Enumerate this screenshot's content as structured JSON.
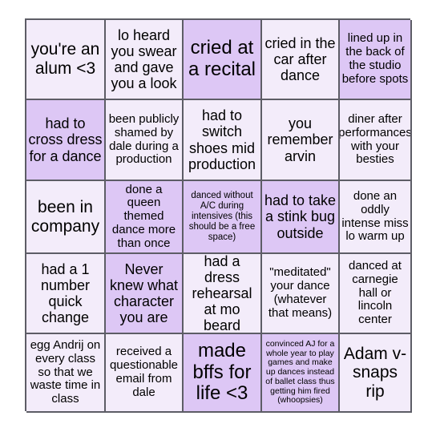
{
  "card": {
    "type": "bingo-card",
    "rows": 5,
    "columns": 5,
    "colors": {
      "cell_background": "#f3ecfa",
      "cell_marked_background": "#ddc7f5",
      "border": "#5d5d66",
      "text": "#000000",
      "page_background": "#ffffff"
    },
    "cells": [
      {
        "id": "r1c1",
        "text": "you're an alum <3",
        "marked": false,
        "size": "sz-lg"
      },
      {
        "id": "r1c2",
        "text": "lo heard you swear and gave you a look",
        "marked": false,
        "size": "sz-md"
      },
      {
        "id": "r1c3",
        "text": "cried at a recital",
        "marked": true,
        "size": "sz-xl"
      },
      {
        "id": "r1c4",
        "text": "cried in the car after dance",
        "marked": false,
        "size": "sz-md"
      },
      {
        "id": "r1c5",
        "text": "lined up in the back of the studio before spots",
        "marked": true,
        "size": "sz-sm"
      },
      {
        "id": "r2c1",
        "text": "had to cross dress for a dance",
        "marked": true,
        "size": "sz-md"
      },
      {
        "id": "r2c2",
        "text": "been publicly shamed by dale during a production",
        "marked": false,
        "size": "sz-sm"
      },
      {
        "id": "r2c3",
        "text": "had to switch shoes mid production",
        "marked": false,
        "size": "sz-md"
      },
      {
        "id": "r2c4",
        "text": "you remember arvin",
        "marked": false,
        "size": "sz-md"
      },
      {
        "id": "r2c5",
        "text": "diner after performances with your besties",
        "marked": false,
        "size": "sz-sm"
      },
      {
        "id": "r3c1",
        "text": "been in company",
        "marked": false,
        "size": "sz-lg"
      },
      {
        "id": "r3c2",
        "text": "done a queen themed dance more than once",
        "marked": true,
        "size": "sz-sm"
      },
      {
        "id": "r3c3",
        "text": "danced without A/C during intensives (this should be a free space)",
        "marked": true,
        "size": "sz-xs"
      },
      {
        "id": "r3c4",
        "text": "had to take a stink bug outside",
        "marked": true,
        "size": "sz-md"
      },
      {
        "id": "r3c5",
        "text": "done an oddly intense miss lo warm up",
        "marked": false,
        "size": "sz-sm"
      },
      {
        "id": "r4c1",
        "text": "had a 1 number quick change",
        "marked": false,
        "size": "sz-md"
      },
      {
        "id": "r4c2",
        "text": "Never knew what character you are",
        "marked": true,
        "size": "sz-md"
      },
      {
        "id": "r4c3",
        "text": "had a dress rehearsal at mo beard",
        "marked": false,
        "size": "sz-md"
      },
      {
        "id": "r4c4",
        "text": "\"meditated\" your dance (whatever that means)",
        "marked": false,
        "size": "sz-sm"
      },
      {
        "id": "r4c5",
        "text": "danced at carnegie hall or lincoln center",
        "marked": false,
        "size": "sz-sm"
      },
      {
        "id": "r5c1",
        "text": "egg Andrij on every class so that we waste time in class",
        "marked": false,
        "size": "sz-sm"
      },
      {
        "id": "r5c2",
        "text": "received a questionable email from dale",
        "marked": false,
        "size": "sz-sm"
      },
      {
        "id": "r5c3",
        "text": "made bffs for life <3",
        "marked": true,
        "size": "sz-xl"
      },
      {
        "id": "r5c4",
        "text": "convinced AJ for a whole year to play games and make up dances instead of ballet class thus getting him fired (whoopsies)",
        "marked": true,
        "size": "sz-xxs"
      },
      {
        "id": "r5c5",
        "text": "Adam v-snaps rip",
        "marked": false,
        "size": "sz-lg"
      }
    ]
  }
}
